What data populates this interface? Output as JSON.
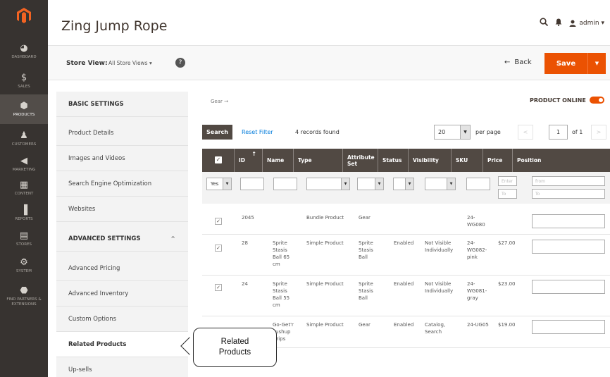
{
  "admin_nav": {
    "items": [
      {
        "icon": "dashboard-icon",
        "label": "Dashboard",
        "glyph": "◕"
      },
      {
        "icon": "dollar-icon",
        "label": "Sales",
        "glyph": "$"
      },
      {
        "icon": "box-icon",
        "label": "Products",
        "glyph": "⬢"
      },
      {
        "icon": "person-icon",
        "label": "Customers",
        "glyph": "♟"
      },
      {
        "icon": "megaphone-icon",
        "label": "Marketing",
        "glyph": "◀"
      },
      {
        "icon": "content-icon",
        "label": "Content",
        "glyph": "▦"
      },
      {
        "icon": "bar-chart-icon",
        "label": "Reports",
        "glyph": "▐"
      },
      {
        "icon": "store-icon",
        "label": "Stores",
        "glyph": "▤"
      },
      {
        "icon": "gear-icon",
        "label": "System",
        "glyph": "⚙"
      },
      {
        "icon": "partners-icon",
        "label": "Find Partners & Extensions",
        "glyph": "⬣"
      }
    ]
  },
  "header": {
    "title": "Zing Jump Rope",
    "admin_label": "admin ▾"
  },
  "actionbar": {
    "store_view_label": "Store View:",
    "store_view_value": "All Store Views ▾",
    "back_label": "Back",
    "save_label": "Save"
  },
  "sidebar": {
    "basic_settings": "BASIC SETTINGS",
    "basic_items": [
      "Product Details",
      "Images and Videos",
      "Search Engine Optimization",
      "Websites"
    ],
    "advanced_settings": "ADVANCED SETTINGS",
    "advanced_items": [
      "Advanced Pricing",
      "Advanced Inventory",
      "Custom Options",
      "Related Products",
      "Up-sells"
    ]
  },
  "main": {
    "breadcrumb": "Gear →",
    "product_online": "PRODUCT ONLINE",
    "search_button": "Search",
    "reset_filter": "Reset Filter",
    "records_found": "4 records found",
    "per_page_value": "20",
    "per_page_label": "per page",
    "page_current": "1",
    "page_of": "of 1"
  },
  "grid": {
    "columns": [
      "ID",
      "Name",
      "Type",
      "Attribute Set",
      "Status",
      "Visibility",
      "SKU",
      "Price",
      "Position"
    ],
    "filters": {
      "yes_value": "Yes",
      "from_placeholder": "from",
      "to_placeholder": "To",
      "price_from": "Enter",
      "price_to": "To"
    },
    "rows": [
      {
        "id": "2045",
        "name": "",
        "type": "Bundle Product",
        "attribute_set": "Gear",
        "status": "",
        "visibility": "",
        "sku": "24-\nWG080",
        "price": ""
      },
      {
        "id": "28",
        "name": "Sprite\nStasis\nBall 65\ncm",
        "type": "Simple Product",
        "attribute_set": "Sprite\nStasis\nBall",
        "status": "Enabled",
        "visibility": "Not Visible\nIndividually",
        "sku": "24-\nWG082-\npink",
        "price": "$27.00"
      },
      {
        "id": "24",
        "name": "Sprite\nStasis\nBall 55\ncm",
        "type": "Simple Product",
        "attribute_set": "Sprite\nStasis\nBall",
        "status": "Enabled",
        "visibility": "Not Visible\nIndividually",
        "sku": "24-\nWG081-\ngray",
        "price": "$23.00"
      },
      {
        "id": "",
        "name": "Go-Get'r\nPushup\nGrips",
        "type": "Simple Product",
        "attribute_set": "Gear",
        "status": "Enabled",
        "visibility": "Catalog,\nSearch",
        "sku": "24-UG05",
        "price": "$19.00"
      }
    ]
  },
  "callout": {
    "line1": "Related",
    "line2": "Products"
  },
  "colors": {
    "nav_bg": "#373330",
    "accent": "#eb5202",
    "grid_header": "#514943",
    "link": "#007bdb"
  }
}
